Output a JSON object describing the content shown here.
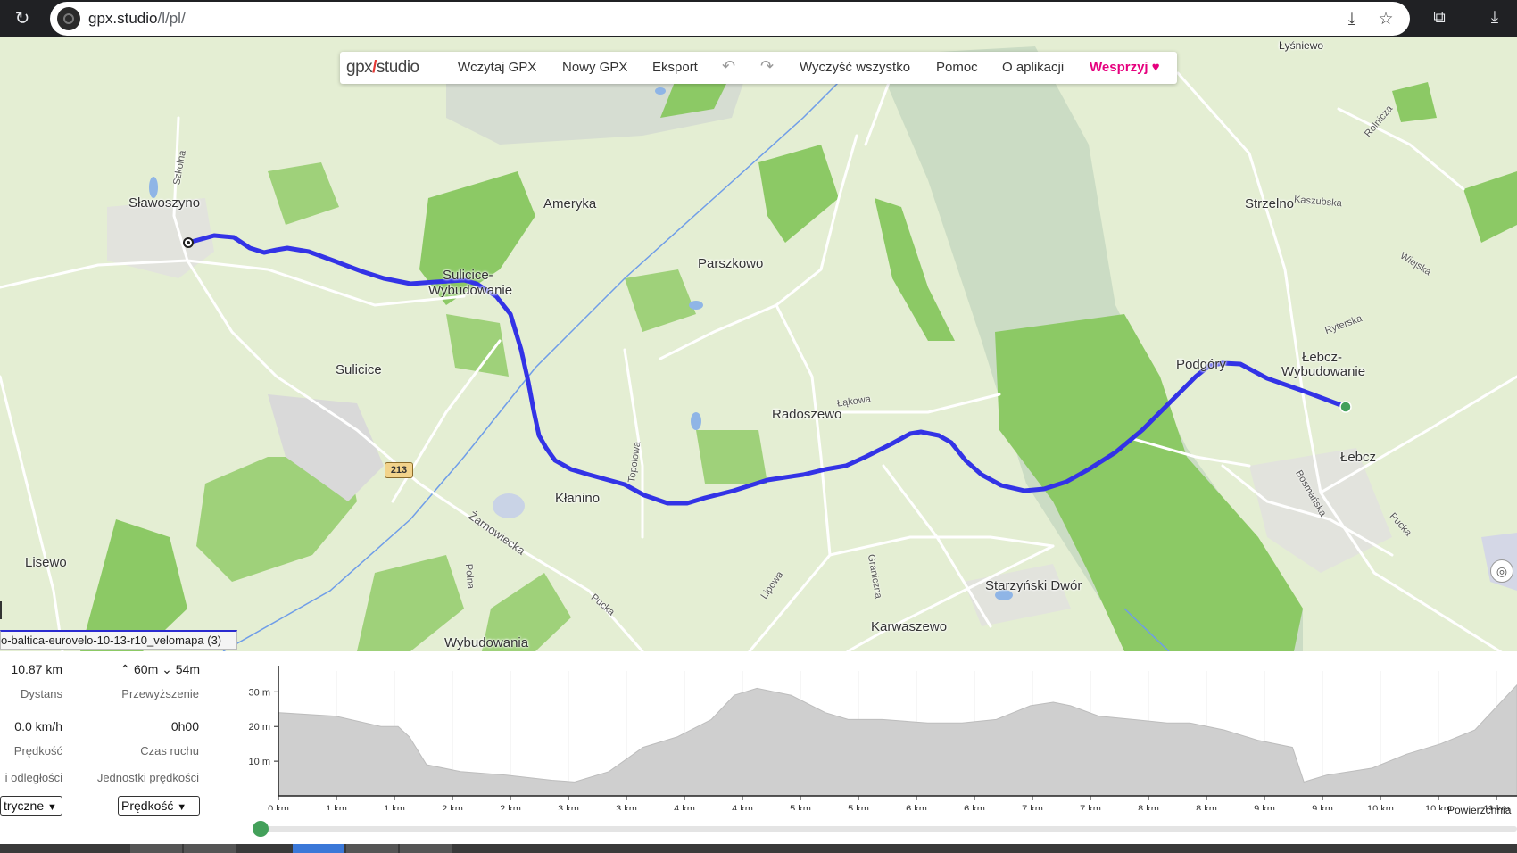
{
  "browser": {
    "url_host": "gpx.studio",
    "url_path": "/l/pl/"
  },
  "toolbar": {
    "logo_left": "gpx",
    "logo_right": "studio",
    "load_gpx": "Wczytaj GPX",
    "new_gpx": "Nowy GPX",
    "export": "Eksport",
    "clear_all": "Wyczyść wszystko",
    "help": "Pomoc",
    "about": "O aplikacji",
    "support": "Wesprzyj"
  },
  "map": {
    "places": [
      "Sławoszyno",
      "Ameryka",
      "Sulicice-",
      "Wybudowanie",
      "Parszkowo",
      "Sulicice",
      "Radoszewo",
      "Kłanino",
      "Lisewo",
      "Wybudowania",
      "Karwaszewo",
      "Starzyński Dwór",
      "Podgóry",
      "Łebcz-",
      "Wybudowanie",
      "Łebcz",
      "Strzelno",
      "Łyśniewo"
    ],
    "streets": [
      "Szkolna",
      "Kaszubska",
      "Rolnicza",
      "Wiejska",
      "Ryterska",
      "Łąkowa",
      "Topolowa",
      "Żarnowiecka",
      "Polna",
      "Pucka",
      "Lipowa",
      "Graniczna",
      "Bosmańska",
      "Pucka"
    ],
    "road_number": "213"
  },
  "file_tab": "o-baltica-eurovelo-10-13-r10_velomapa (3)",
  "stats": {
    "distance_value": "10.87 km",
    "distance_label": "Dystans",
    "elev_up": "60m",
    "elev_down": "54m",
    "elevation_label": "Przewyższenie",
    "speed_value": "0.0 km/h",
    "speed_label": "Prędkość",
    "moving_time_value": "0h00",
    "moving_time_label": "Czas ruchu",
    "distance_units_label": "i odległości",
    "speed_units_label": "Jednostki prędkości",
    "distance_units_select": "tryczne",
    "speed_units_select": "Prędkość"
  },
  "elevation_chart": {
    "y_ticks": [
      "30 m",
      "20 m",
      "10 m"
    ],
    "x_ticks": [
      "0 km",
      "1 km",
      "1 km",
      "2 km",
      "2 km",
      "3 km",
      "3 km",
      "4 km",
      "4 km",
      "5 km",
      "5 km",
      "6 km",
      "6 km",
      "7 km",
      "7 km",
      "8 km",
      "8 km",
      "9 km",
      "9 km",
      "10 km",
      "10 km",
      "11 km"
    ],
    "surface_label": "Powierzchnia"
  },
  "chart_data": {
    "type": "area",
    "xlabel": "",
    "ylabel": "",
    "ylim": [
      0,
      36
    ],
    "xlim": [
      0,
      10.87
    ],
    "series": [
      {
        "x": [
          0,
          0.5,
          0.9,
          1.05,
          1.15,
          1.3,
          1.6,
          2.0,
          2.4,
          2.6,
          2.9,
          3.2,
          3.5,
          3.8,
          4.0,
          4.2,
          4.5,
          4.8,
          5.0,
          5.3,
          5.7,
          6.0,
          6.3,
          6.6,
          6.8,
          6.95,
          7.2,
          7.5,
          7.8,
          8.0,
          8.3,
          8.6,
          8.9,
          9.0,
          9.2,
          9.6,
          9.9,
          10.2,
          10.5,
          10.87
        ],
        "y": [
          24,
          23,
          20,
          20,
          17,
          9,
          7,
          6,
          4.5,
          4,
          7,
          14,
          17,
          22,
          29,
          31,
          29,
          24,
          22,
          22,
          21,
          21,
          22,
          26,
          27,
          26,
          23,
          22,
          21,
          21,
          19,
          16,
          14,
          4,
          6,
          8,
          12,
          15,
          19,
          32
        ]
      }
    ]
  },
  "colors": {
    "track": "#3333e6",
    "accent": "#e6007e",
    "forest": "#8cc965",
    "elevation_fill": "#cfcfcf"
  }
}
